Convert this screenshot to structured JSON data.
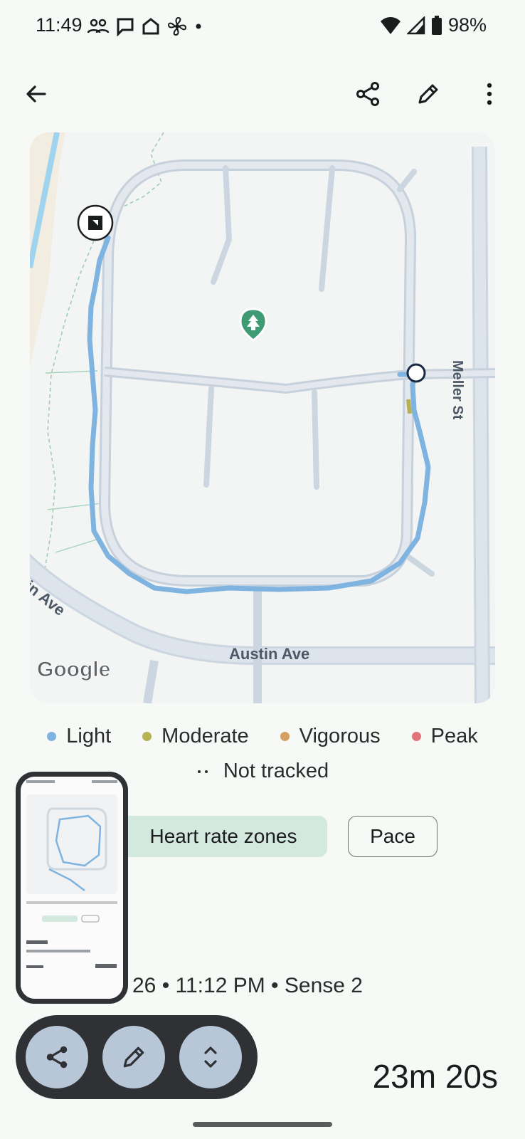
{
  "status_bar": {
    "time": "11:49",
    "battery": "98%",
    "left_icons": [
      "people-icon",
      "message-icon",
      "home-icon",
      "fan-icon",
      "dot-icon"
    ],
    "right_icons": [
      "wifi-icon",
      "signal-icon",
      "battery-icon"
    ]
  },
  "toolbar": {
    "back_icon": "back-arrow-icon",
    "share_icon": "share-icon",
    "edit_icon": "edit-icon",
    "more_icon": "more-vert-icon"
  },
  "map": {
    "street_labels": [
      "Meller St",
      "Austin Ave",
      "tin Ave"
    ],
    "attribution": "Google",
    "route_color": "#7fb3e0",
    "park_marker_color": "#3f9b74"
  },
  "legend": {
    "items": [
      {
        "label": "Light",
        "color": "#7fb3e0"
      },
      {
        "label": "Moderate",
        "color": "#b7b354"
      },
      {
        "label": "Vigorous",
        "color": "#d6a062"
      },
      {
        "label": "Peak",
        "color": "#e0747a"
      }
    ],
    "not_tracked": "Not tracked"
  },
  "chips": {
    "heart_rate": "Heart rate zones",
    "pace": "Pace"
  },
  "activity": {
    "meta": "26 • 11:12 PM • Sense 2",
    "duration": "23m 20s"
  },
  "fab_bar": {
    "share_icon": "share-icon",
    "edit_icon": "edit-icon",
    "expand_icon": "unfold-icon"
  }
}
